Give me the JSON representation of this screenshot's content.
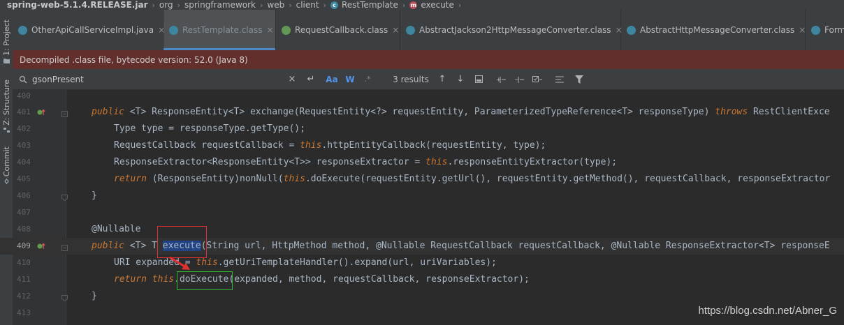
{
  "breadcrumb": {
    "items": [
      {
        "label": "spring-web-5.1.4.RELEASE.jar",
        "bold": true
      },
      {
        "label": "org"
      },
      {
        "label": "springframework"
      },
      {
        "label": "web"
      },
      {
        "label": "client"
      },
      {
        "label": "RestTemplate",
        "icon": "class-icon"
      },
      {
        "label": "execute",
        "icon": "method-icon"
      }
    ]
  },
  "left_strip": {
    "project_label": "1: Project",
    "structure_label": "Z: Structure",
    "commit_label": "Commit"
  },
  "tabs": [
    {
      "label": "OtherApiCallServiceImpl.java",
      "icon": "class-icon",
      "active": false
    },
    {
      "label": "RestTemplate.class",
      "icon": "class-icon",
      "active": true
    },
    {
      "label": "RequestCallback.class",
      "icon": "interface-icon",
      "active": false
    },
    {
      "label": "AbstractJackson2HttpMessageConverter.class",
      "icon": "abstract-class-icon",
      "active": false
    },
    {
      "label": "AbstractHttpMessageConverter.class",
      "icon": "abstract-class-icon",
      "active": false
    },
    {
      "label": "Form",
      "icon": "class-icon",
      "active": false
    }
  ],
  "banner": {
    "text": "Decompiled .class file, bytecode version: 52.0 (Java 8)"
  },
  "find": {
    "query": "gsonPresent",
    "match_case_label": "Aa",
    "words_label": "W",
    "regex_label": ".*",
    "results": "3 results"
  },
  "editor": {
    "lines": [
      {
        "n": "400",
        "code": ""
      },
      {
        "n": "401",
        "code": "exchange-line"
      },
      {
        "n": "402",
        "code": ""
      },
      {
        "n": "403",
        "code": ""
      },
      {
        "n": "404",
        "code": ""
      },
      {
        "n": "405",
        "code": ""
      },
      {
        "n": "406",
        "code": ""
      },
      {
        "n": "407",
        "code": ""
      },
      {
        "n": "408",
        "code": ""
      },
      {
        "n": "409",
        "code": "execute-line"
      },
      {
        "n": "410",
        "code": ""
      },
      {
        "n": "411",
        "code": ""
      },
      {
        "n": "412",
        "code": ""
      },
      {
        "n": "413",
        "code": ""
      }
    ],
    "code_text": {
      "l401_kw": "public",
      "l401_rest": " <T> ResponseEntity<T> exchange(RequestEntity<?> requestEntity, ParameterizedTypeReference<T> responseType) ",
      "l401_throws": "throws",
      "l401_tail": " RestClientExce",
      "l402": "Type type = responseType.getType();",
      "l403_a": "RequestCallback requestCallback = ",
      "l403_this": "this",
      "l403_b": ".httpEntityCallback(requestEntity, type);",
      "l404_a": "ResponseExtractor<ResponseEntity<T>> responseExtractor = ",
      "l404_this": "this",
      "l404_b": ".responseEntityExtractor(type);",
      "l405_ret": "return",
      "l405_a": " (ResponseEntity)nonNull(",
      "l405_this": "this",
      "l405_b": ".doExecute(requestEntity.getUrl(), requestEntity.getMethod(), requestCallback, responseExtractor",
      "l406": "}",
      "l408": "@Nullable",
      "l409_kw": "public",
      "l409_a": " <T> T ",
      "l409_method": "execute",
      "l409_b": "(String url, HttpMethod method, ",
      "l409_ann1": "@Nullable",
      "l409_c": " RequestCallback requestCallback, ",
      "l409_ann2": "@Nullable",
      "l409_d": " ResponseExtractor<T> responseE",
      "l410_a": "URI expanded = ",
      "l410_this": "this",
      "l410_b": ".getUriTemplateHandler().expand(url, uriVariables);",
      "l411_ret": "return",
      "l411_sp": " ",
      "l411_this": "this",
      "l411_dot": ".",
      "l411_method": "doExecute",
      "l411_b": "(expanded, method, requestCallback, responseExtractor);",
      "l412": "}"
    }
  },
  "watermark": "https://blog.csdn.net/Abner_G",
  "colors": {
    "class_icon": "#3e86a0",
    "interface_icon": "#629755",
    "method_icon": "#b44e58",
    "annotation_box": "#e03030",
    "highlight_box": "#2eb82e",
    "arrow": "#e03030"
  }
}
